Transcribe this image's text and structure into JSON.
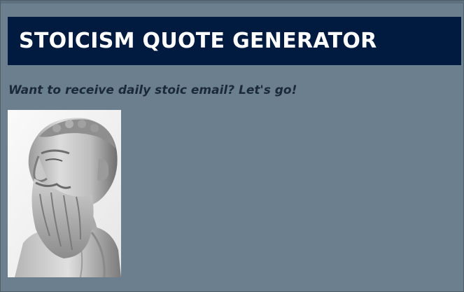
{
  "page": {
    "title": "STOICISM QUOTE GENERATOR",
    "tagline": "Want to receive daily stoic email? Let's go!"
  },
  "image": {
    "subject": "marble bust of a bearded stoic philosopher",
    "icon": "bust-photo"
  },
  "colors": {
    "page_background": "#6b7f8e",
    "header_background": "#001a40",
    "title_text": "#ffffff",
    "tagline_text": "#1a2a3a"
  }
}
